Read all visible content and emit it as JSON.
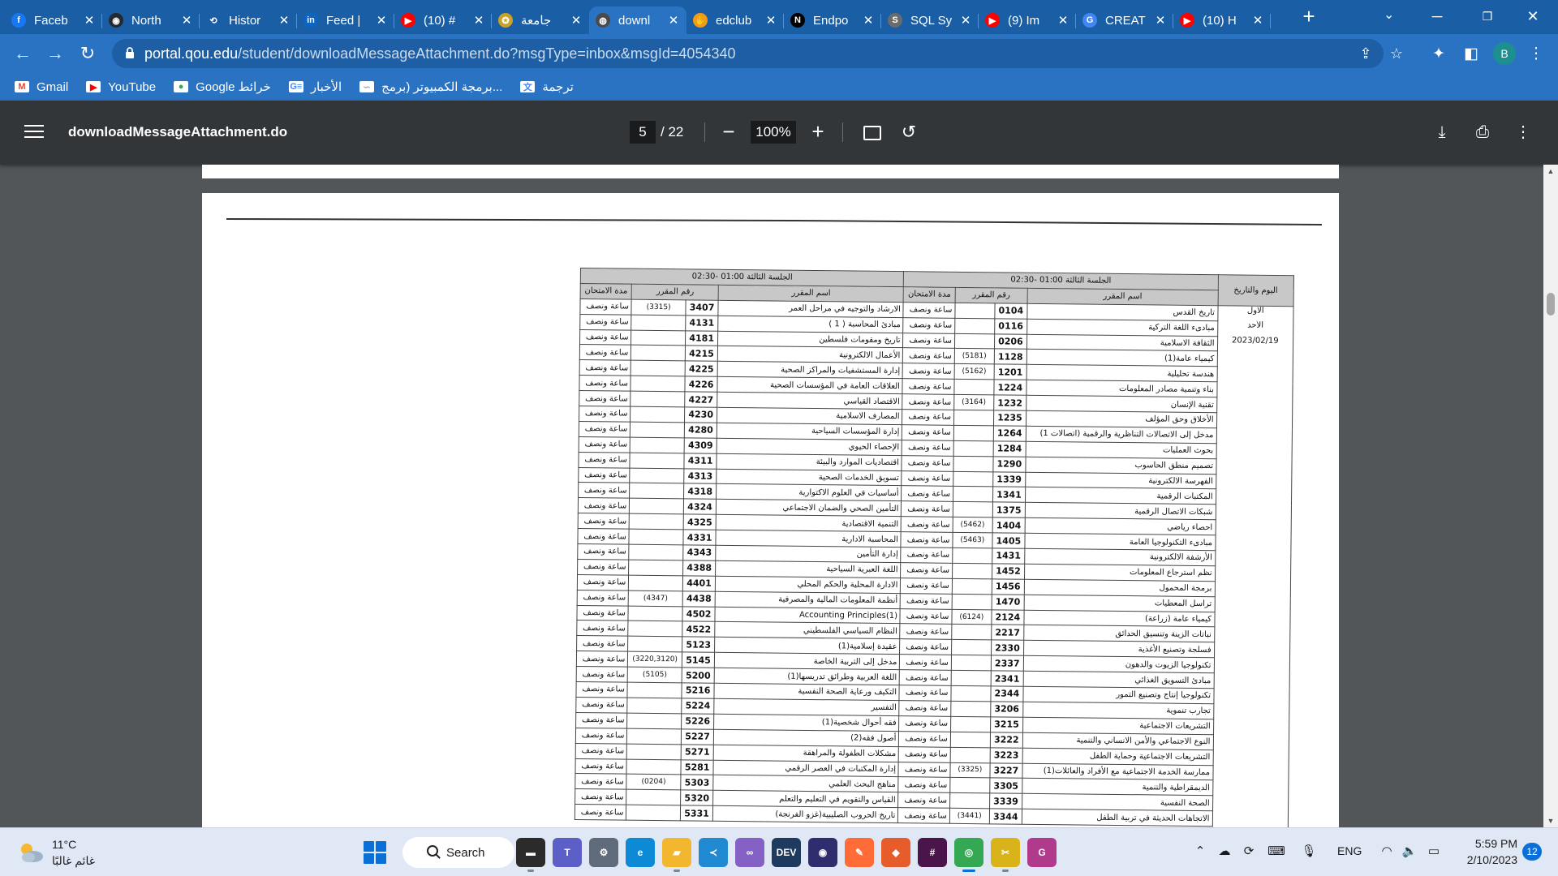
{
  "browser": {
    "tabs": [
      {
        "title": "Faceb",
        "icon": "facebook-icon",
        "color": "#1877f2",
        "glyph": "f"
      },
      {
        "title": "North",
        "icon": "github-icon",
        "color": "#24292f",
        "glyph": "◉"
      },
      {
        "title": "Histor",
        "icon": "history-icon",
        "color": "#1a5fa6",
        "glyph": "⟲"
      },
      {
        "title": "Feed |",
        "icon": "linkedin-icon",
        "color": "#0a66c2",
        "glyph": "in"
      },
      {
        "title": "(10) #",
        "icon": "youtube-icon",
        "color": "#ff0000",
        "glyph": "▶"
      },
      {
        "title": "جامعة",
        "icon": "university-icon",
        "color": "#c9a227",
        "glyph": "✪"
      },
      {
        "title": "downl",
        "icon": "globe-icon",
        "color": "#4a4a4a",
        "glyph": "◍"
      },
      {
        "title": "edclub",
        "icon": "edclub-icon",
        "color": "#f39c12",
        "glyph": "✋"
      },
      {
        "title": "Endpo",
        "icon": "notion-icon",
        "color": "#000000",
        "glyph": "N"
      },
      {
        "title": "SQL Sy",
        "icon": "sql-icon",
        "color": "#6b6b6b",
        "glyph": "S"
      },
      {
        "title": "(9) Im",
        "icon": "youtube-icon",
        "color": "#ff0000",
        "glyph": "▶"
      },
      {
        "title": "CREAT",
        "icon": "google-icon",
        "color": "#4285f4",
        "glyph": "G"
      },
      {
        "title": "(10) H",
        "icon": "youtube-icon",
        "color": "#ff0000",
        "glyph": "▶"
      }
    ],
    "active_tab_index": 6,
    "url_host": "portal.qou.edu",
    "url_path": "/student/downloadMessageAttachment.do?msgType=inbox&msgId=4054340",
    "profile_initial": "B",
    "bookmarks": [
      {
        "label": "Gmail",
        "icon": "gmail-icon",
        "color": "#ea4335",
        "glyph": "M"
      },
      {
        "label": "YouTube",
        "icon": "youtube-icon",
        "color": "#ff0000",
        "glyph": "▶"
      },
      {
        "label": "Google خرائط",
        "icon": "maps-icon",
        "color": "#34a853",
        "glyph": "●"
      },
      {
        "label": "الأخبار",
        "icon": "news-icon",
        "color": "#4285f4",
        "glyph": "G≡"
      },
      {
        "label": "برمجة الكمبيوتر (برمج...",
        "icon": "page-icon",
        "color": "#9aa8b8",
        "glyph": "∽"
      },
      {
        "label": "ترجمة",
        "icon": "translate-icon",
        "color": "#4285f4",
        "glyph": "文"
      }
    ]
  },
  "pdf": {
    "title": "downloadMessageAttachment.do",
    "page": "5",
    "page_total": "/ 22",
    "zoom": "100%"
  },
  "schedule": {
    "header_left_session": "الجلسة الثالثة 01:00 -02:30",
    "header_right_session": "الجلسة الثالثة 01:00 -02:30",
    "col_duration": "مدة الامتحان",
    "col_code": "رقم المقرر",
    "col_name": "اسم المقرر",
    "col_day": "اليوم والتاريخ",
    "day_label": "الاول",
    "day_name": "الأحد",
    "day_date": "2023/02/19",
    "duration_text": "ساعة ونصف",
    "left_rows": [
      {
        "ref": "(3315)",
        "code": "3407",
        "name": "الارشاد والتوجيه في مراحل العمر"
      },
      {
        "ref": "",
        "code": "4131",
        "name": "مبادئ المحاسبة ( 1 )"
      },
      {
        "ref": "",
        "code": "4181",
        "name": "تاريخ ومقومات فلسطين"
      },
      {
        "ref": "",
        "code": "4215",
        "name": "الأعمال الالكترونية"
      },
      {
        "ref": "",
        "code": "4225",
        "name": "إدارة المستشفيات والمراكز الصحية"
      },
      {
        "ref": "",
        "code": "4226",
        "name": "العلاقات العامة في المؤسسات الصحية"
      },
      {
        "ref": "",
        "code": "4227",
        "name": "الاقتصاد القياسي"
      },
      {
        "ref": "",
        "code": "4230",
        "name": "المصارف الاسلامية"
      },
      {
        "ref": "",
        "code": "4280",
        "name": "إدارة المؤسسات السياحية"
      },
      {
        "ref": "",
        "code": "4309",
        "name": "الإحصاء الحيوي"
      },
      {
        "ref": "",
        "code": "4311",
        "name": "اقتصاديات الموارد والبيئة"
      },
      {
        "ref": "",
        "code": "4313",
        "name": "تسويق الخدمات الصحية"
      },
      {
        "ref": "",
        "code": "4318",
        "name": "أساسيات في العلوم الاكتوارية"
      },
      {
        "ref": "",
        "code": "4324",
        "name": "التأمين الصحي والضمان الاجتماعي"
      },
      {
        "ref": "",
        "code": "4325",
        "name": "التنمية الاقتصادية"
      },
      {
        "ref": "",
        "code": "4331",
        "name": "المحاسبة الادارية"
      },
      {
        "ref": "",
        "code": "4343",
        "name": "إدارة التأمين"
      },
      {
        "ref": "",
        "code": "4388",
        "name": "اللغة العبرية السياحية"
      },
      {
        "ref": "",
        "code": "4401",
        "name": "الادارة المحلية والحكم المحلي"
      },
      {
        "ref": "(4347)",
        "code": "4438",
        "name": "أنظمة المعلومات المالية والمصرفية"
      },
      {
        "ref": "",
        "code": "4502",
        "name": "Accounting Principles(1)"
      },
      {
        "ref": "",
        "code": "4522",
        "name": "النظام السياسي الفلسطيني"
      },
      {
        "ref": "",
        "code": "5123",
        "name": "عقيدة إسلامية(1)"
      },
      {
        "ref": "(3220,3120)",
        "code": "5145",
        "name": "مدخل إلى التربية الخاصة"
      },
      {
        "ref": "(5105)",
        "code": "5200",
        "name": "اللغة العربية وطرائق تدريسها(1)"
      },
      {
        "ref": "",
        "code": "5216",
        "name": "التكيف ورعاية الصحة النفسية"
      },
      {
        "ref": "",
        "code": "5224",
        "name": "التفسير"
      },
      {
        "ref": "",
        "code": "5226",
        "name": "فقه أحوال شخصية(1)"
      },
      {
        "ref": "",
        "code": "5227",
        "name": "أصول فقه(2)"
      },
      {
        "ref": "",
        "code": "5271",
        "name": "مشكلات الطفولة والمراهقة"
      },
      {
        "ref": "",
        "code": "5281",
        "name": "إدارة المكتبات في العصر الرقمي"
      },
      {
        "ref": "(0204)",
        "code": "5303",
        "name": "مناهج البحث العلمي"
      },
      {
        "ref": "",
        "code": "5320",
        "name": "القياس والتقويم في التعليم والتعلم"
      },
      {
        "ref": "",
        "code": "5331",
        "name": "تاريخ الحروب الصليبية(غزو الفرنجة)"
      }
    ],
    "right_rows": [
      {
        "ref": "",
        "code": "0104",
        "name": "تاريخ القدس"
      },
      {
        "ref": "",
        "code": "0116",
        "name": "مبادىء اللغة التركية"
      },
      {
        "ref": "",
        "code": "0206",
        "name": "الثقافة الاسلامية"
      },
      {
        "ref": "(5181)",
        "code": "1128",
        "name": "كيمياء عامة(1)"
      },
      {
        "ref": "(5162)",
        "code": "1201",
        "name": "هندسة تحليلية"
      },
      {
        "ref": "",
        "code": "1224",
        "name": "بناء وتنمية مصادر المعلومات"
      },
      {
        "ref": "(3164)",
        "code": "1232",
        "name": "تقنية الإنسان"
      },
      {
        "ref": "",
        "code": "1235",
        "name": "الأخلاق وحق المؤلف"
      },
      {
        "ref": "",
        "code": "1264",
        "name": "مدخل إلى الاتصالات التناظرية والرقمية (اتصالات 1)"
      },
      {
        "ref": "",
        "code": "1284",
        "name": "بحوث العمليات"
      },
      {
        "ref": "",
        "code": "1290",
        "name": "تصميم منطق الحاسوب"
      },
      {
        "ref": "",
        "code": "1339",
        "name": "الفهرسة الالكترونية"
      },
      {
        "ref": "",
        "code": "1341",
        "name": "المكتبات الرقمية"
      },
      {
        "ref": "",
        "code": "1375",
        "name": "شبكات الاتصال الرقمية"
      },
      {
        "ref": "(5462)",
        "code": "1404",
        "name": "احصاء رياضي"
      },
      {
        "ref": "(5463)",
        "code": "1405",
        "name": "مبادىء التكنولوجيا العامة"
      },
      {
        "ref": "",
        "code": "1431",
        "name": "الأرشفة الالكترونية"
      },
      {
        "ref": "",
        "code": "1452",
        "name": "نظم استرجاع المعلومات"
      },
      {
        "ref": "",
        "code": "1456",
        "name": "برمجة المحمول"
      },
      {
        "ref": "",
        "code": "1470",
        "name": "تراسل المعطيات"
      },
      {
        "ref": "(6124)",
        "code": "2124",
        "name": "كيمياء عامة (زراعة)"
      },
      {
        "ref": "",
        "code": "2217",
        "name": "نباتات الزينة وتنسيق الحدائق"
      },
      {
        "ref": "",
        "code": "2330",
        "name": "فسلجة وتصنيع الأغذية"
      },
      {
        "ref": "",
        "code": "2337",
        "name": "تكنولوجيا الزيوت والدهون"
      },
      {
        "ref": "",
        "code": "2341",
        "name": "مبادئ التسويق الغذائي"
      },
      {
        "ref": "",
        "code": "2344",
        "name": "تكنولوجيا إنتاج وتصنيع التمور"
      },
      {
        "ref": "",
        "code": "3206",
        "name": "تجارب تنموية"
      },
      {
        "ref": "",
        "code": "3215",
        "name": "التشريعات الاجتماعية"
      },
      {
        "ref": "",
        "code": "3222",
        "name": "النوع الاجتماعي والأمن الانساني والتنمية"
      },
      {
        "ref": "",
        "code": "3223",
        "name": "التشريعات الاجتماعية وحماية الطفل"
      },
      {
        "ref": "(3325)",
        "code": "3227",
        "name": "ممارسة الخدمة الاجتماعية مع الأفراد والعائلات(1)"
      },
      {
        "ref": "",
        "code": "3305",
        "name": "الديمقراطية والتنمية"
      },
      {
        "ref": "",
        "code": "3339",
        "name": "الصحة النفسية"
      },
      {
        "ref": "(3441)",
        "code": "3344",
        "name": "الاتجاهات الحديثة في تربية الطفل"
      }
    ]
  },
  "taskbar": {
    "weather_temp": "11°C",
    "weather_desc": "غائم غالبًا",
    "search_label": "Search",
    "language": "ENG",
    "time": "5:59 PM",
    "date": "2/10/2023",
    "notification_count": "12",
    "apps": [
      {
        "name": "file-explorer-app-icon",
        "glyph": "▬",
        "color": "#2b2b2b"
      },
      {
        "name": "teams-app-icon",
        "glyph": "T",
        "color": "#5b5fc7"
      },
      {
        "name": "settings-app-icon",
        "glyph": "⚙",
        "color": "#5f6b7a"
      },
      {
        "name": "edge-app-icon",
        "glyph": "e",
        "color": "#0c8ad6"
      },
      {
        "name": "folder-app-icon",
        "glyph": "▰",
        "color": "#f2b72e"
      },
      {
        "name": "vscode-app-icon",
        "glyph": "≺",
        "color": "#1f8ad2"
      },
      {
        "name": "visual-studio-app-icon",
        "glyph": "∞",
        "color": "#8661c5"
      },
      {
        "name": "dev-app-icon",
        "glyph": "DEV",
        "color": "#1e3a5f"
      },
      {
        "name": "media-app-icon",
        "glyph": "◉",
        "color": "#2e2e6e"
      },
      {
        "name": "postman-app-icon",
        "glyph": "✎",
        "color": "#ff6c37"
      },
      {
        "name": "git-app-icon",
        "glyph": "◆",
        "color": "#e65c2b"
      },
      {
        "name": "slack-app-icon",
        "glyph": "#",
        "color": "#4a154b"
      },
      {
        "name": "chrome-app-icon",
        "glyph": "◎",
        "color": "#34a853"
      },
      {
        "name": "paint-app-icon",
        "glyph": "✂",
        "color": "#d9b31a"
      },
      {
        "name": "pdf-app-icon",
        "glyph": "G",
        "color": "#b03a8c"
      }
    ]
  }
}
